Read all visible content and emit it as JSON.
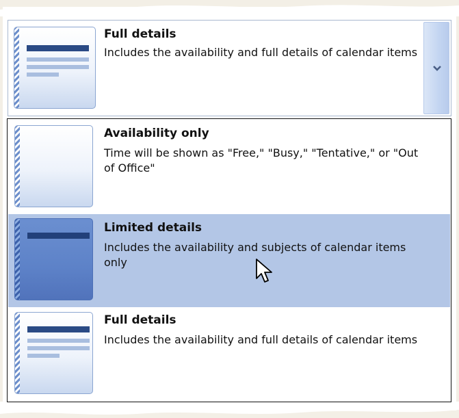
{
  "selected": {
    "title": "Full details",
    "description": "Includes the availability and full details of calendar items",
    "icon": "full-details-thumbnail-icon"
  },
  "options": [
    {
      "title": "Availability only",
      "description": "Time will be shown as \"Free,\" \"Busy,\" \"Tentative,\" or \"Out of Office\"",
      "icon": "availability-only-thumbnail-icon",
      "highlighted": false
    },
    {
      "title": "Limited details",
      "description": "Includes the availability and subjects of calendar items only",
      "icon": "limited-details-thumbnail-icon",
      "highlighted": true
    },
    {
      "title": "Full details",
      "description": "Includes the availability and full details of calendar items",
      "icon": "full-details-thumbnail-icon",
      "highlighted": false
    }
  ],
  "colors": {
    "highlight": "#b3c6e6",
    "accent_dark": "#2a4a85",
    "thumbnail_border": "#8aa5d1"
  }
}
